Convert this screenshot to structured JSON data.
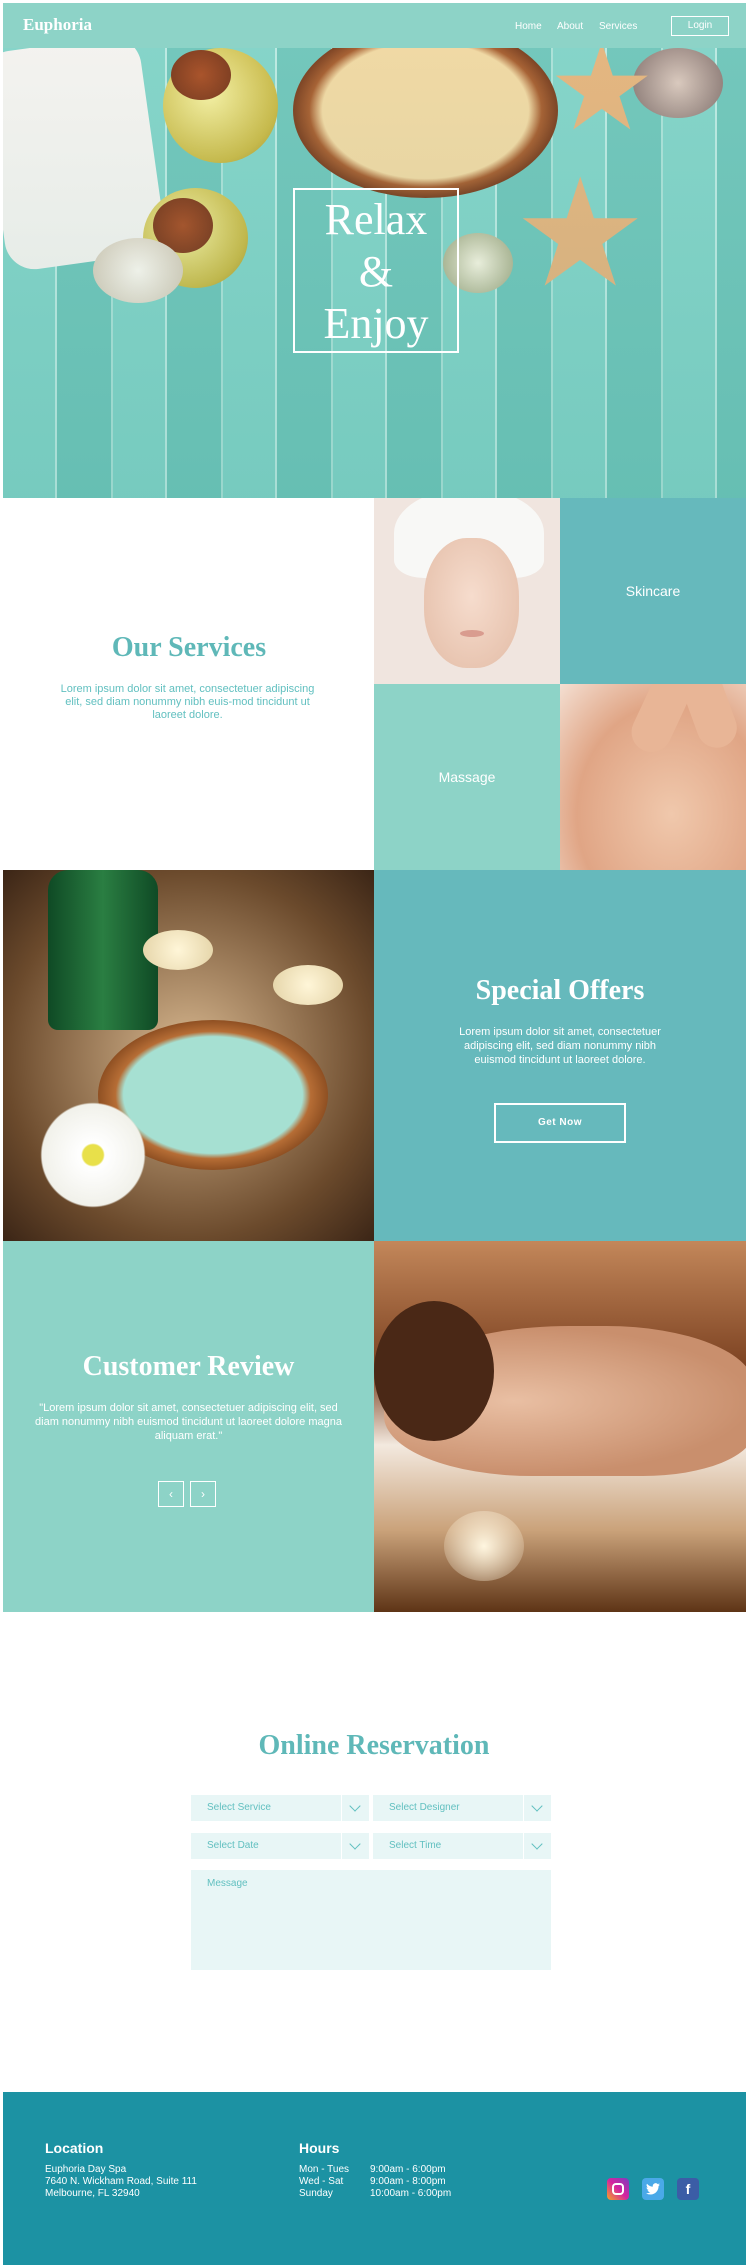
{
  "header": {
    "logo": "Euphoria",
    "nav": {
      "home": "Home",
      "about": "About",
      "services": "Services"
    },
    "login": "Login"
  },
  "hero": {
    "line1": "Relax",
    "line2": "&",
    "line3": "Enjoy"
  },
  "services": {
    "title": "Our Services",
    "text": "Lorem ipsum dolor sit amet, consectetuer adipiscing elit, sed diam nonummy nibh euis-mod tincidunt ut laoreet dolore.",
    "tiles": {
      "skincare": "Skincare",
      "massage": "Massage"
    }
  },
  "offers": {
    "title": "Special Offers",
    "text": "Lorem ipsum dolor sit amet, consectetuer adipiscing elit, sed diam nonummy nibh euismod tincidunt ut laoreet dolore.",
    "button": "Get Now"
  },
  "review": {
    "title": "Customer Review",
    "text": "\"Lorem ipsum dolor sit amet, consectetuer adipiscing elit, sed diam nonummy nibh euismod tincidunt ut laoreet dolore magna aliquam erat.\"",
    "prev": "‹",
    "next": "›"
  },
  "reservation": {
    "title": "Online Reservation",
    "service_placeholder": "Select Service",
    "designer_placeholder": "Select Designer",
    "date_placeholder": "Select Date",
    "time_placeholder": "Select Time",
    "message_placeholder": "Message"
  },
  "footer": {
    "location_title": "Location",
    "location_lines": [
      "Euphoria Day Spa",
      "7640 N. Wickham Road, Suite 111",
      "Melbourne, FL 32940"
    ],
    "hours_title": "Hours",
    "hours": [
      {
        "days": "Mon - Tues",
        "time": "9:00am - 6:00pm"
      },
      {
        "days": "Wed - Sat",
        "time": "9:00am - 8:00pm"
      },
      {
        "days": "Sunday",
        "time": "10:00am - 6:00pm"
      }
    ],
    "social": {
      "twitter": "",
      "facebook": "f"
    }
  },
  "colors": {
    "header": "#8dd3c7",
    "teal_dark": "#66b9bc",
    "teal_light": "#8dd3c7",
    "title_text": "#5fb8b8",
    "field_bg": "#e8f6f6",
    "footer": "#1c92a3"
  },
  "icons": [
    "chevron-down-icon",
    "instagram-icon",
    "twitter-icon",
    "facebook-icon",
    "arrow-left-icon",
    "arrow-right-icon"
  ]
}
